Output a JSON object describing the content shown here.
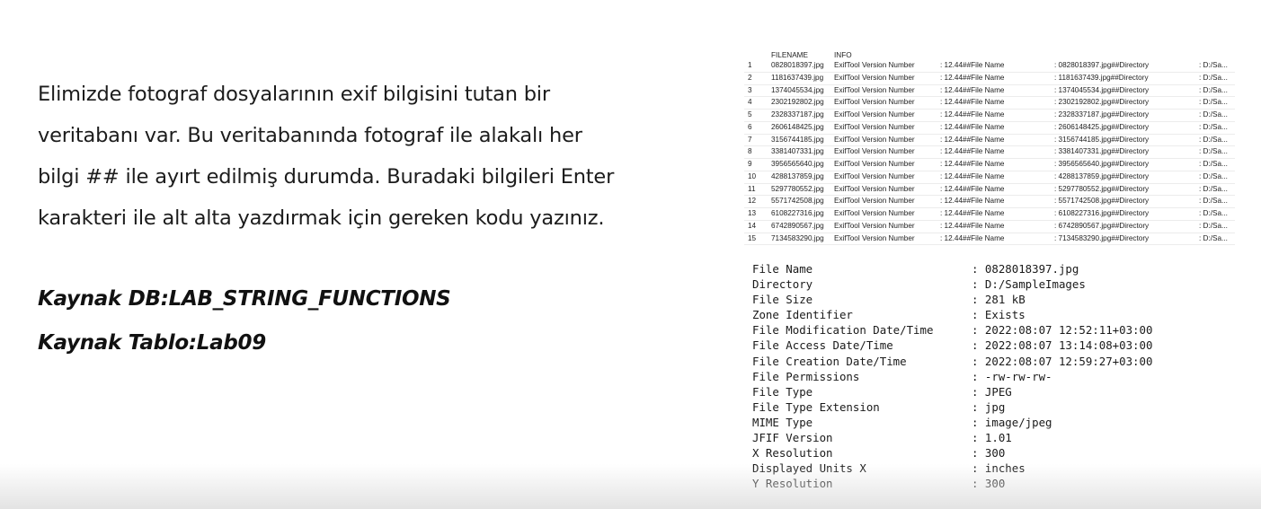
{
  "description": {
    "lines": [
      "Elimizde fotograf dosyalarının exif bilgisini tutan bir",
      "veritabanı var. Bu veritabanında fotograf ile alakalı her",
      "bilgi ## ile ayırt edilmiş durumda. Buradaki bilgileri Enter",
      "karakteri ile alt alta yazdırmak için gereken kodu yazınız."
    ]
  },
  "source": {
    "db": "Kaynak DB:LAB_STRING_FUNCTIONS",
    "table": "Kaynak Tablo:Lab09"
  },
  "results_grid": {
    "columns": [
      "FILENAME",
      "INFO"
    ],
    "rows": [
      {
        "idx": "1",
        "filename": "0828018397.jpg",
        "info": "ExifTool Version Number",
        "ver": ": 12.44##File Name",
        "name": ": 0828018397.jpg##Directory",
        "dir": ": D:/Sa..."
      },
      {
        "idx": "2",
        "filename": "1181637439.jpg",
        "info": "ExifTool Version Number",
        "ver": ": 12.44##File Name",
        "name": ": 1181637439.jpg##Directory",
        "dir": ": D:/Sa..."
      },
      {
        "idx": "3",
        "filename": "1374045534.jpg",
        "info": "ExifTool Version Number",
        "ver": ": 12.44##File Name",
        "name": ": 1374045534.jpg##Directory",
        "dir": ": D:/Sa..."
      },
      {
        "idx": "4",
        "filename": "2302192802.jpg",
        "info": "ExifTool Version Number",
        "ver": ": 12.44##File Name",
        "name": ": 2302192802.jpg##Directory",
        "dir": ": D:/Sa..."
      },
      {
        "idx": "5",
        "filename": "2328337187.jpg",
        "info": "ExifTool Version Number",
        "ver": ": 12.44##File Name",
        "name": ": 2328337187.jpg##Directory",
        "dir": ": D:/Sa..."
      },
      {
        "idx": "6",
        "filename": "2606148425.jpg",
        "info": "ExifTool Version Number",
        "ver": ": 12.44##File Name",
        "name": ": 2606148425.jpg##Directory",
        "dir": ": D:/Sa..."
      },
      {
        "idx": "7",
        "filename": "3156744185.jpg",
        "info": "ExifTool Version Number",
        "ver": ": 12.44##File Name",
        "name": ": 3156744185.jpg##Directory",
        "dir": ": D:/Sa..."
      },
      {
        "idx": "8",
        "filename": "3381407331.jpg",
        "info": "ExifTool Version Number",
        "ver": ": 12.44##File Name",
        "name": ": 3381407331.jpg##Directory",
        "dir": ": D:/Sa..."
      },
      {
        "idx": "9",
        "filename": "3956565640.jpg",
        "info": "ExifTool Version Number",
        "ver": ": 12.44##File Name",
        "name": ": 3956565640.jpg##Directory",
        "dir": ": D:/Sa..."
      },
      {
        "idx": "10",
        "filename": "4288137859.jpg",
        "info": "ExifTool Version Number",
        "ver": ": 12.44##File Name",
        "name": ": 4288137859.jpg##Directory",
        "dir": ": D:/Sa..."
      },
      {
        "idx": "11",
        "filename": "5297780552.jpg",
        "info": "ExifTool Version Number",
        "ver": ": 12.44##File Name",
        "name": ": 5297780552.jpg##Directory",
        "dir": ": D:/Sa..."
      },
      {
        "idx": "12",
        "filename": "5571742508.jpg",
        "info": "ExifTool Version Number",
        "ver": ": 12.44##File Name",
        "name": ": 5571742508.jpg##Directory",
        "dir": ": D:/Sa..."
      },
      {
        "idx": "13",
        "filename": "6108227316.jpg",
        "info": "ExifTool Version Number",
        "ver": ": 12.44##File Name",
        "name": ": 6108227316.jpg##Directory",
        "dir": ": D:/Sa..."
      },
      {
        "idx": "14",
        "filename": "6742890567.jpg",
        "info": "ExifTool Version Number",
        "ver": ": 12.44##File Name",
        "name": ": 6742890567.jpg##Directory",
        "dir": ": D:/Sa..."
      },
      {
        "idx": "15",
        "filename": "7134583290.jpg",
        "info": "ExifTool Version Number",
        "ver": ": 12.44##File Name",
        "name": ": 7134583290.jpg##Directory",
        "dir": ": D:/Sa..."
      }
    ]
  },
  "exif_output": [
    {
      "key": "File Name",
      "value": ": 0828018397.jpg"
    },
    {
      "key": "Directory",
      "value": ": D:/SampleImages"
    },
    {
      "key": "File Size",
      "value": ": 281 kB"
    },
    {
      "key": "Zone Identifier",
      "value": ": Exists"
    },
    {
      "key": "File Modification Date/Time",
      "value": ": 2022:08:07 12:52:11+03:00"
    },
    {
      "key": "File Access Date/Time",
      "value": ": 2022:08:07 13:14:08+03:00"
    },
    {
      "key": "File Creation Date/Time",
      "value": ": 2022:08:07 12:59:27+03:00"
    },
    {
      "key": "File Permissions",
      "value": ": -rw-rw-rw-"
    },
    {
      "key": "File Type",
      "value": ": JPEG"
    },
    {
      "key": "File Type Extension",
      "value": ": jpg"
    },
    {
      "key": "MIME Type",
      "value": ": image/jpeg"
    },
    {
      "key": "JFIF Version",
      "value": ": 1.01"
    },
    {
      "key": "X Resolution",
      "value": ": 300"
    },
    {
      "key": "Displayed Units X",
      "value": ": inches"
    },
    {
      "key": "Y Resolution",
      "value": ": 300"
    }
  ]
}
